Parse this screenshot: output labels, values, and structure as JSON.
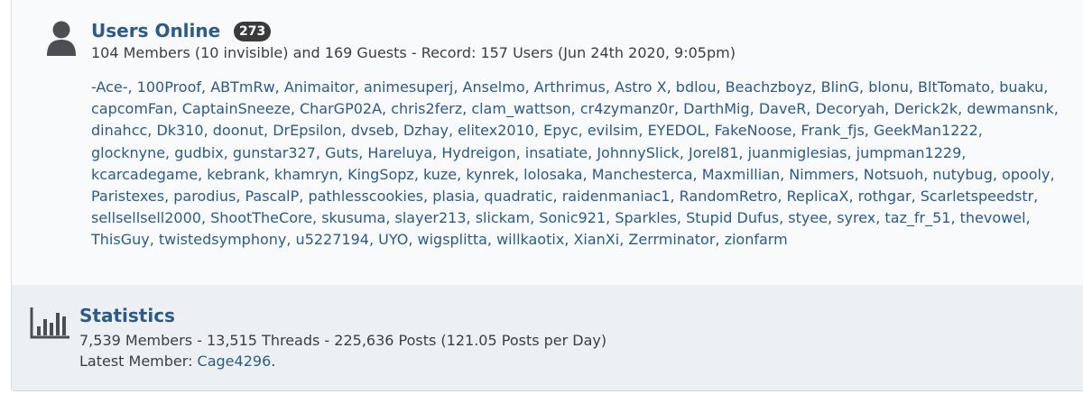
{
  "online": {
    "title": "Users Online",
    "count_badge": "273",
    "summary": "104 Members (10 invisible) and 169 Guests - Record: 157 Users (Jun 24th 2020, 9:05pm)",
    "members": [
      "-Ace-",
      "100Proof",
      "ABTmRw",
      "Animaitor",
      "animesuperj",
      "Anselmo",
      "Arthrimus",
      "Astro X",
      "bdlou",
      "Beachzboyz",
      "BlinG",
      "blonu",
      "BltTomato",
      "buaku",
      "capcomFan",
      "CaptainSneeze",
      "CharGP02A",
      "chris2ferz",
      "clam_wattson",
      "cr4zymanz0r",
      "DarthMig",
      "DaveR",
      "Decoryah",
      "Derick2k",
      "dewmansnk",
      "dinahcc",
      "Dk310",
      "doonut",
      "DrEpsilon",
      "dvseb",
      "Dzhay",
      "elitex2010",
      "Epyc",
      "evilsim",
      "EYEDOL",
      "FakeNoose",
      "Frank_fjs",
      "GeekMan1222",
      "glocknyne",
      "gudbix",
      "gunstar327",
      "Guts",
      "Hareluya",
      "Hydreigon",
      "insatiate",
      "JohnnySlick",
      "Jorel81",
      "juanmiglesias",
      "jumpman1229",
      "kcarcadegame",
      "kebrank",
      "khamryn",
      "KingSopz",
      "kuze",
      "kynrek",
      "lolosaka",
      "Manchesterca",
      "Maxmillian",
      "Nimmers",
      "Notsuoh",
      "nutybug",
      "opooly",
      "Paristexes",
      "parodius",
      "PascalP",
      "pathlesscookies",
      "plasia",
      "quadratic",
      "raidenmaniac1",
      "RandomRetro",
      "ReplicaX",
      "rothgar",
      "Scarletspeedstr",
      "sellsellsell2000",
      "ShootTheCore",
      "skusuma",
      "slayer213",
      "slickam",
      "Sonic921",
      "Sparkles",
      "Stupid Dufus",
      "styee",
      "syrex",
      "taz_fr_51",
      "thevowel",
      "ThisGuy",
      "twistedsymphony",
      "u5227194",
      "UYO",
      "wigsplitta",
      "willkaotix",
      "XianXi",
      "Zerrminator",
      "zionfarm"
    ]
  },
  "statistics": {
    "title": "Statistics",
    "line1": "7,539 Members - 13,515 Threads - 225,636 Posts (121.05 Posts per Day)",
    "latest_label": "Latest Member:",
    "latest_member": "Cage4296",
    "latest_suffix": "."
  },
  "icons": {
    "online": "user-silhouette-icon",
    "stats": "bar-chart-icon"
  },
  "colors": {
    "link": "#2a5b8a",
    "badge_bg": "#3a3a3a",
    "icon": "#4b4f54"
  }
}
